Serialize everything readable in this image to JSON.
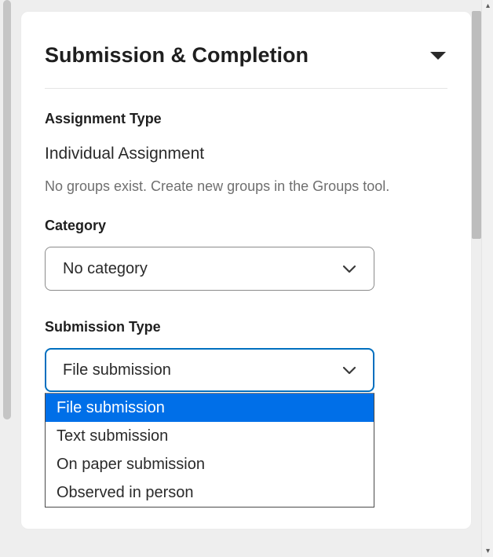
{
  "panel": {
    "title": "Submission & Completion"
  },
  "assignment_type": {
    "label": "Assignment Type",
    "value": "Individual Assignment",
    "help": "No groups exist. Create new groups in the Groups tool."
  },
  "category": {
    "label": "Category",
    "selected": "No category"
  },
  "submission_type": {
    "label": "Submission Type",
    "selected": "File submission",
    "options": [
      "File submission",
      "Text submission",
      "On paper submission",
      "Observed in person"
    ]
  }
}
